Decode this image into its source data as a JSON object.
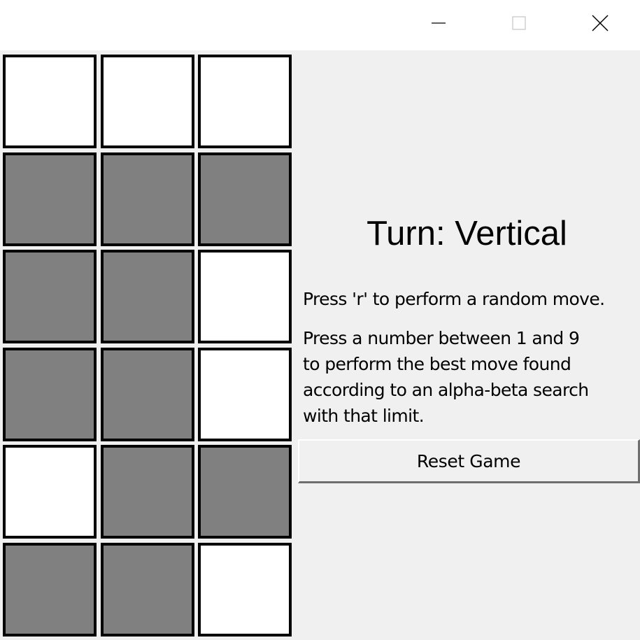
{
  "titlebar": {
    "minimize_icon": "minimize-icon",
    "maximize_icon": "maximize-icon",
    "close_icon": "close-icon"
  },
  "board": {
    "rows": 6,
    "cols": 3,
    "cells": [
      [
        "white",
        "white",
        "white"
      ],
      [
        "gray",
        "gray",
        "gray"
      ],
      [
        "gray",
        "gray",
        "white"
      ],
      [
        "gray",
        "gray",
        "white"
      ],
      [
        "white",
        "gray",
        "gray"
      ],
      [
        "gray",
        "gray",
        "white"
      ]
    ],
    "colors": {
      "white": "#ffffff",
      "gray": "#808080",
      "border": "#000000"
    }
  },
  "panel": {
    "turn_text": "Turn: Vertical",
    "random_hint": "Press 'r' to perform a random move.",
    "search_hint": "Press a number between 1 and 9\nto perform the best move found\naccording to an alpha-beta search\nwith that limit.",
    "reset_label": "Reset Game"
  }
}
